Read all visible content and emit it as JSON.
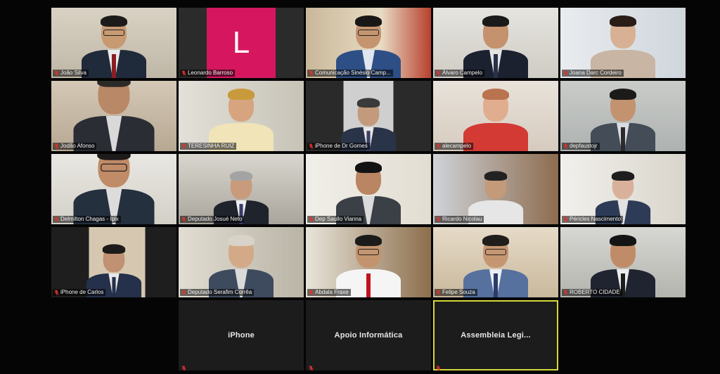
{
  "meeting": {
    "colors": {
      "background": "#050505",
      "tile": "#2b2b2b",
      "blank_tile": "#1c1c1c",
      "active_speaker_border": "#d8d83a",
      "mic_muted": "#e0322b",
      "avatar_l": "#d6175f"
    },
    "participants": [
      {
        "name": "João Silva"
      },
      {
        "name": "Leonardo Barroso",
        "avatar_letter": "L"
      },
      {
        "name": "Comunicação Sinésio Camp..."
      },
      {
        "name": "Álvaro Campelo"
      },
      {
        "name": "Joana Darc Cordeiro"
      },
      {
        "name": "Jodão Afonso"
      },
      {
        "name": "TERESINHA RUIZ"
      },
      {
        "name": "iPhone de Dr Gomes"
      },
      {
        "name": "alecampelo"
      },
      {
        "name": "depfaustojr"
      },
      {
        "name": "Delmilton Chagas - Ipix"
      },
      {
        "name": "Deputado Josué Neto"
      },
      {
        "name": "Dep Saullo Vianna"
      },
      {
        "name": "Ricardo Nicolau"
      },
      {
        "name": "Péricles Nascimento"
      },
      {
        "name": "iPhone de Carlos"
      },
      {
        "name": "Deputado Serafim Corrêa"
      },
      {
        "name": "Abdala Fraxe"
      },
      {
        "name": "Felipe Souza"
      },
      {
        "name": "ROBERTO CIDADE"
      },
      {
        "name": "iPhone"
      },
      {
        "name": "Apoio Informática"
      },
      {
        "name": "Assembleia  Legi..."
      }
    ]
  }
}
